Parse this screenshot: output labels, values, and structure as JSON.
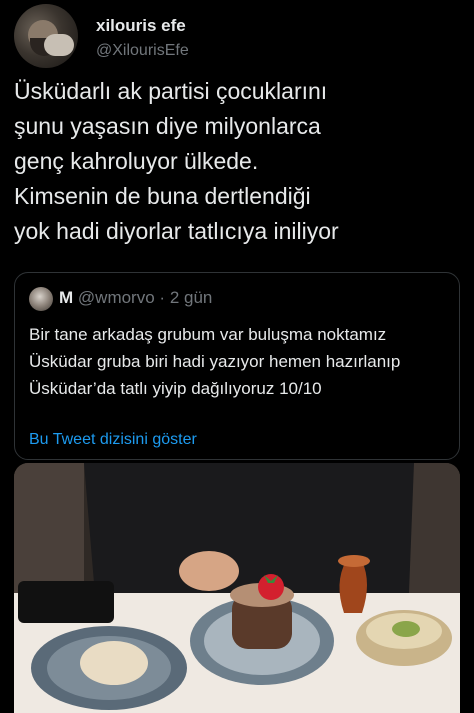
{
  "author": {
    "display_name": "xilouris efe",
    "handle": "@XilourisEfe"
  },
  "tweet": {
    "text": "Üsküdarlı ak partisi çocuklarını\nşunu yaşasın diye milyonlarca\ngenç kahroluyor ülkede.\nKimsenin de buna dertlendiği\nyok hadi diyorlar tatlıcıya iniliyor"
  },
  "quoted": {
    "display_name": "M",
    "handle": "@wmorvo",
    "separator": "·",
    "time": "2 gün",
    "text": "Bir tane arkadaş grubum var buluşma noktamız Üsküdar gruba biri hadi yazıyor hemen hazırlanıp Üsküdar’da tatlı yiyip dağılıyoruz 10/10",
    "show_thread_label": "Bu Tweet dizisini göster"
  },
  "colors": {
    "background": "#000000",
    "text_primary": "#e7e9ea",
    "text_secondary": "#71767b",
    "link": "#1d9bf0",
    "border": "#2f3336"
  }
}
